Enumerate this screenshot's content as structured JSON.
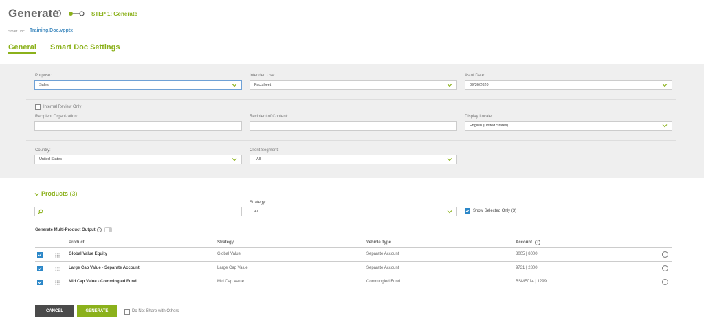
{
  "header": {
    "title": "Generate",
    "help": "?",
    "step_label": "STEP 1: Generate",
    "doc_prefix": "Smart Doc:",
    "doc_name": "Training.Doc.vpptx"
  },
  "tabs": [
    {
      "label": "General",
      "active": true
    },
    {
      "label": "Smart Doc Settings",
      "active": false
    }
  ],
  "form": {
    "purpose": {
      "label": "Purpose:",
      "value": "Sales"
    },
    "intended_use": {
      "label": "Intended Use:",
      "value": "Factsheet"
    },
    "as_of_date": {
      "label": "As of Date:",
      "value": "09/30/2020"
    },
    "internal_review": {
      "label": "Internal Review Only",
      "checked": false
    },
    "recipient_org": {
      "label": "Recipient Organization:",
      "value": ""
    },
    "recipient_content": {
      "label": "Recipient of Content:",
      "value": ""
    },
    "display_locale": {
      "label": "Display Locale:",
      "value": "English (United States)"
    },
    "country": {
      "label": "Country:",
      "value": "United States"
    },
    "client_segment": {
      "label": "Client Segment:",
      "value": "- All -"
    }
  },
  "products": {
    "title": "Products",
    "count": "(3)",
    "strategy_label": "Strategy:",
    "strategy_value": "All",
    "search_placeholder": "",
    "show_selected": "Show Selected Only (3)",
    "multi_output_label": "Generate Multi-Product Output",
    "headers": {
      "product": "Product",
      "strategy": "Strategy",
      "vehicle": "Vehicle Type",
      "account": "Account"
    },
    "rows": [
      {
        "product": "Global Value Equity",
        "strategy": "Global Value",
        "vehicle": "Separate Account",
        "account": "8005 | 8000"
      },
      {
        "product": "Large Cap Value - Separate Account",
        "strategy": "Large Cap Value",
        "vehicle": "Separate Account",
        "account": "9731 | 2800"
      },
      {
        "product": "Mid Cap Value - Commingled Fund",
        "strategy": "Mid Cap Value",
        "vehicle": "Commingled Fund",
        "account": "BSMF014 | 1299"
      }
    ]
  },
  "footer": {
    "cancel": "CANCEL",
    "generate": "GENERATE",
    "do_not_share": "Do Not Share with Others"
  },
  "colors": {
    "accent": "#8bb11b",
    "checkbox": "#2b87c8",
    "cancel": "#4a4a4a"
  }
}
